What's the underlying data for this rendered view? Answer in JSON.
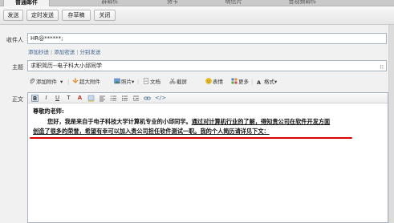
{
  "tabs": [
    {
      "label": "普通邮件",
      "active": true
    },
    {
      "label": "群邮件",
      "active": false
    },
    {
      "label": "贺卡",
      "active": false
    },
    {
      "label": "明信片",
      "active": false
    },
    {
      "label": "音视频邮件",
      "active": false
    }
  ],
  "actions": {
    "send": "发送",
    "scheduled_send": "定时发送",
    "save_draft": "存草稿",
    "close": "关闭"
  },
  "form": {
    "to_label": "收件人",
    "to_value": "HR@******;",
    "add_cc": "添加抄送",
    "add_bcc": "添加密送",
    "separate_send": "分别发送",
    "subject_label": "主题",
    "subject_value": "求职简历--电子科大小邱同学",
    "body_label": "正文"
  },
  "insert_toolbar": {
    "attachment": "添加附件",
    "large_attachment": "超大附件",
    "photo": "照片",
    "document": "文档",
    "screenshot": "截屏",
    "emoji": "表情",
    "more": "更多",
    "format": "格式"
  },
  "format_toolbar": {
    "bold": "B",
    "italic": "I",
    "underline": "U",
    "font_size": "T",
    "text_color": "A",
    "source": "</>"
  },
  "email_body": {
    "greeting": "尊敬的老师:",
    "line1_plain": "您好，我是来自于电子科技大学计算机专业的小邱同学。",
    "line1_underlined": "通过对计算机行业的了解，得知贵公司在软件开发方面",
    "line2_underlined": "创造了很多的荣誉，希望有幸可以加入贵公司担任软件测试一职。我的个人简历请详见下文："
  },
  "colors": {
    "accent_link": "#3a5f8f",
    "annotation_red": "#e00000"
  }
}
